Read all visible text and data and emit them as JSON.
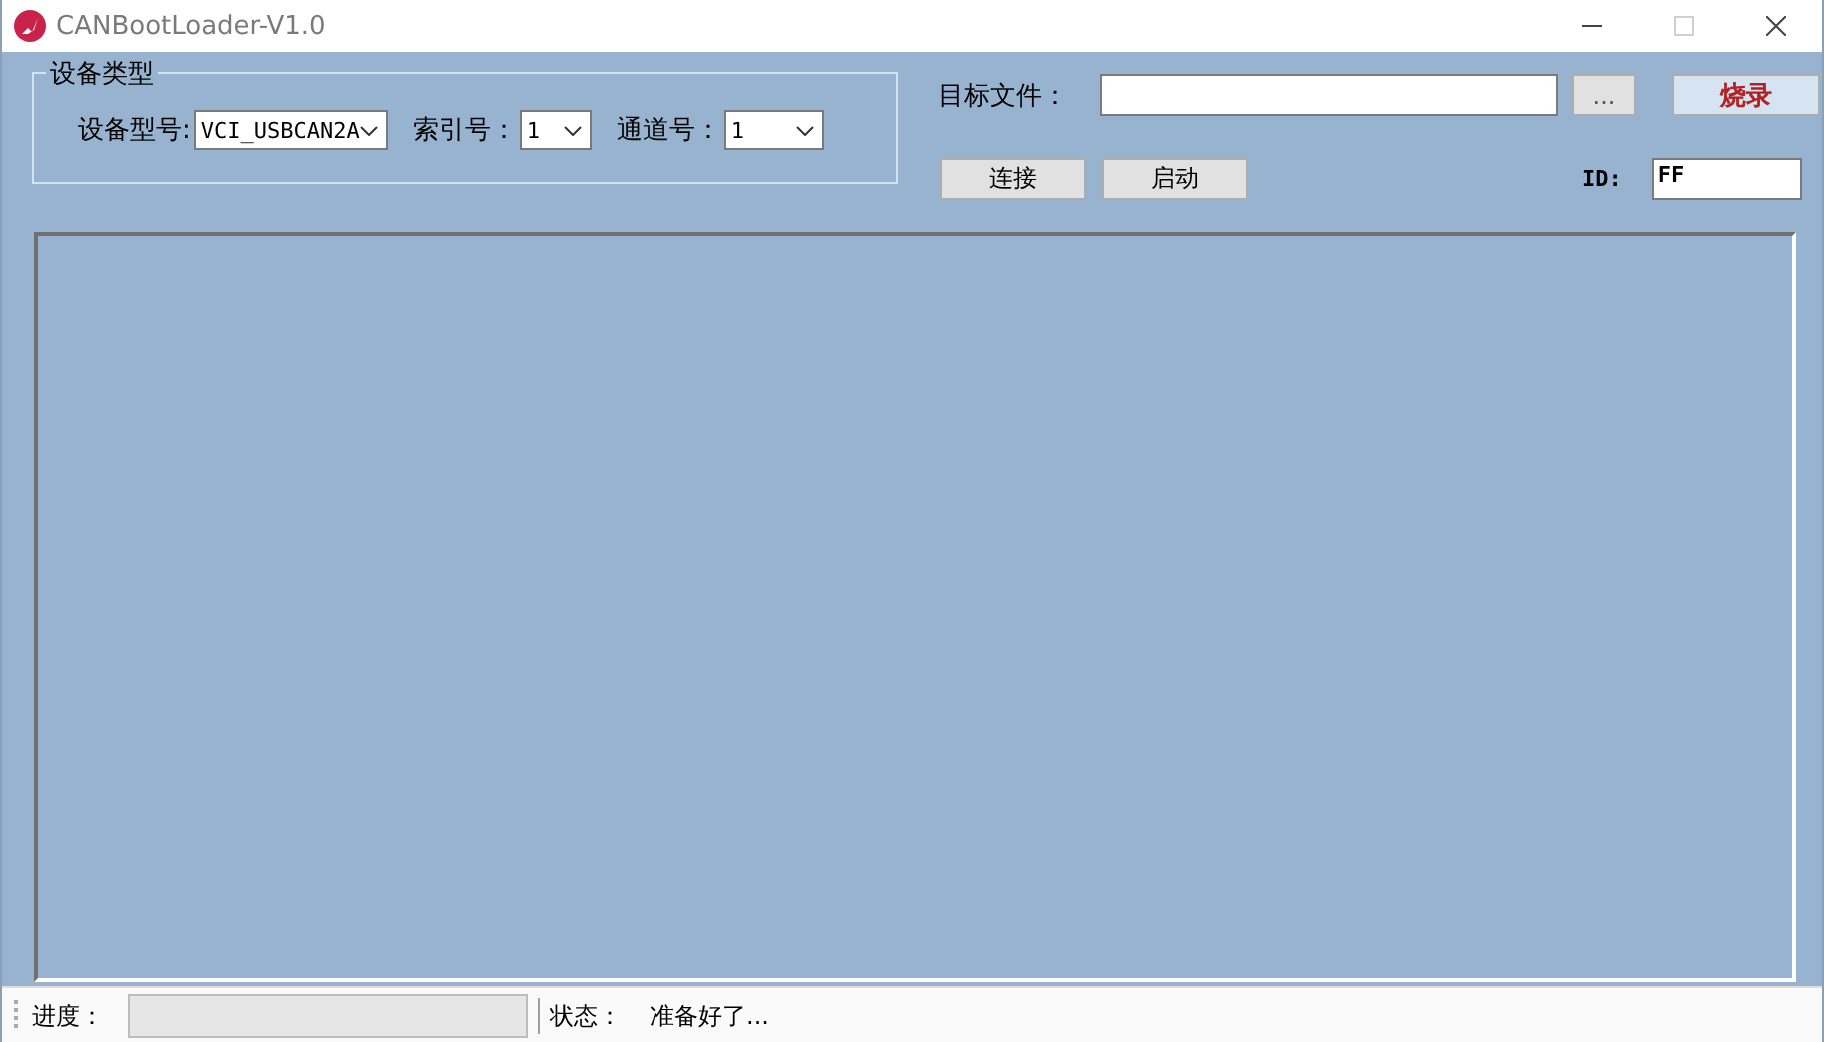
{
  "window": {
    "title": "CANBootLoader-V1.0",
    "controls": [
      {
        "kind": "minimize",
        "disabled": false
      },
      {
        "kind": "maximize",
        "disabled": true
      },
      {
        "kind": "close",
        "disabled": false
      }
    ]
  },
  "device_group": {
    "title": "设备类型",
    "fields": [
      {
        "label": "设备型号:",
        "value": "VCI_USBCAN2A"
      },
      {
        "label": "索引号：",
        "value": "1"
      },
      {
        "label": "通道号：",
        "value": "1"
      }
    ]
  },
  "target_file": {
    "label": "目标文件：",
    "browse_button": "...",
    "flash_button": "烧录"
  },
  "buttons": [
    "连接",
    "启动"
  ],
  "id_field": {
    "label": "ID:",
    "value": "FF"
  },
  "status_bar": {
    "progress_label": "进度：",
    "progress": {
      "level": 0
    },
    "status_label": "状态：",
    "status": "准备好了..."
  }
}
